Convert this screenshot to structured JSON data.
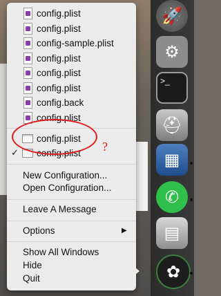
{
  "menu": {
    "recent_files": [
      {
        "label": "config.plist"
      },
      {
        "label": "config.plist"
      },
      {
        "label": "config-sample.plist"
      },
      {
        "label": "config.plist"
      },
      {
        "label": "config.plist"
      },
      {
        "label": "config.plist"
      },
      {
        "label": "config.back"
      },
      {
        "label": "config.plist"
      }
    ],
    "open_windows": [
      {
        "label": "config.plist",
        "checked": false
      },
      {
        "label": "config.plist",
        "checked": true
      }
    ],
    "check_mark": "✓",
    "new_configuration": "New Configuration...",
    "open_configuration": "Open Configuration...",
    "leave_message": "Leave A Message",
    "options": "Options",
    "submenu_arrow": "▶",
    "show_all_windows": "Show All Windows",
    "hide": "Hide",
    "quit": "Quit"
  },
  "annotation": {
    "mark": "?",
    "color": "#e01b1b"
  },
  "dock": {
    "icons": [
      "rocket-icon",
      "system-preferences-icon",
      "terminal-icon",
      "disk-utility-icon",
      "virtualbox-icon",
      "whatsapp-icon",
      "calculator-icon",
      "app-icon"
    ]
  }
}
